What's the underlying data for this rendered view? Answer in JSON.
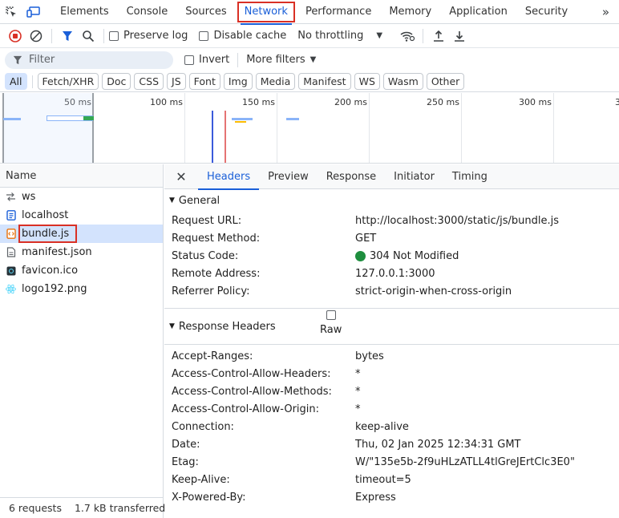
{
  "tabs": [
    {
      "label": "Elements"
    },
    {
      "label": "Console"
    },
    {
      "label": "Sources"
    },
    {
      "label": "Network"
    },
    {
      "label": "Performance"
    },
    {
      "label": "Memory"
    },
    {
      "label": "Application"
    },
    {
      "label": "Security"
    }
  ],
  "more_tabs_label": "»",
  "toolbar": {
    "preserve_log": "Preserve log",
    "disable_cache": "Disable cache",
    "throttling": "No throttling"
  },
  "filter": {
    "placeholder": "Filter",
    "invert": "Invert",
    "more_filters": "More filters"
  },
  "type_chips": [
    "All",
    "Fetch/XHR",
    "Doc",
    "CSS",
    "JS",
    "Font",
    "Img",
    "Media",
    "Manifest",
    "WS",
    "Wasm",
    "Other"
  ],
  "overview": {
    "ticks": [
      "50 ms",
      "100 ms",
      "150 ms",
      "200 ms",
      "250 ms",
      "300 ms",
      "3"
    ]
  },
  "name_header": "Name",
  "requests": [
    {
      "name": "ws",
      "icon": "websocket-icon"
    },
    {
      "name": "localhost",
      "icon": "document-icon"
    },
    {
      "name": "bundle.js",
      "icon": "script-icon"
    },
    {
      "name": "manifest.json",
      "icon": "file-icon"
    },
    {
      "name": "favicon.ico",
      "icon": "image-icon"
    },
    {
      "name": "logo192.png",
      "icon": "react-logo-icon"
    }
  ],
  "status_bar": {
    "requests": "6 requests",
    "transferred": "1.7 kB transferred"
  },
  "detail_tabs": [
    "Headers",
    "Preview",
    "Response",
    "Initiator",
    "Timing"
  ],
  "general": {
    "title": "General",
    "rows": [
      {
        "key": "Request URL:",
        "value": "http://localhost:3000/static/js/bundle.js"
      },
      {
        "key": "Request Method:",
        "value": "GET"
      },
      {
        "key": "Status Code:",
        "value": "304 Not Modified"
      },
      {
        "key": "Remote Address:",
        "value": "127.0.0.1:3000"
      },
      {
        "key": "Referrer Policy:",
        "value": "strict-origin-when-cross-origin"
      }
    ]
  },
  "response_headers": {
    "title": "Response Headers",
    "raw_label": "Raw",
    "rows": [
      {
        "key": "Accept-Ranges:",
        "value": "bytes"
      },
      {
        "key": "Access-Control-Allow-Headers:",
        "value": "*"
      },
      {
        "key": "Access-Control-Allow-Methods:",
        "value": "*"
      },
      {
        "key": "Access-Control-Allow-Origin:",
        "value": "*"
      },
      {
        "key": "Connection:",
        "value": "keep-alive"
      },
      {
        "key": "Date:",
        "value": "Thu, 02 Jan 2025 12:34:31 GMT"
      },
      {
        "key": "Etag:",
        "value": "W/\"135e5b-2f9uHLzATLL4tlGreJErtClc3E0\""
      },
      {
        "key": "Keep-Alive:",
        "value": "timeout=5"
      },
      {
        "key": "X-Powered-By:",
        "value": "Express"
      }
    ]
  },
  "colors": {
    "accent": "#1a5fd8",
    "highlight": "#d93025",
    "status_ok": "#1e8e3e"
  }
}
